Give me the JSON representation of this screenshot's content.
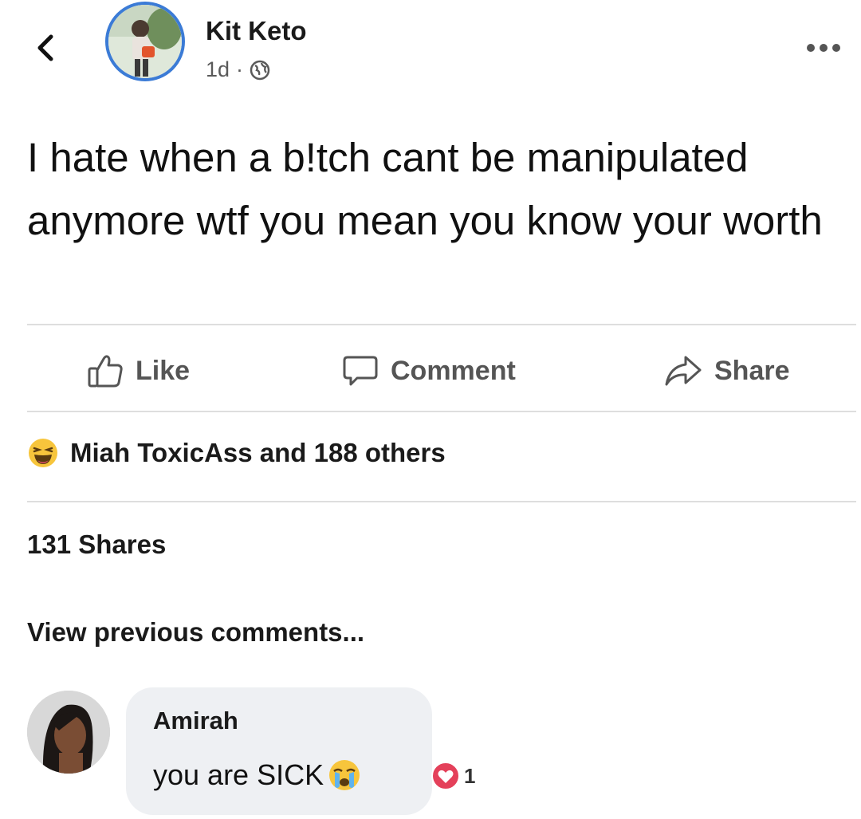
{
  "post": {
    "author": "Kit Keto",
    "time": "1d",
    "separator": "·",
    "visibility_icon": "globe-icon",
    "text": "I hate when a b!tch cant be manipulated anymore wtf you mean you know your worth"
  },
  "actions": {
    "like": "Like",
    "comment": "Comment",
    "share": "Share"
  },
  "reactions": {
    "icon": "laughing-emoji-icon",
    "summary": "Miah ToxicAss and 188 others"
  },
  "shares_count": "131 Shares",
  "view_previous": "View previous comments...",
  "comment": {
    "author": "Amirah",
    "text": "you are SICK",
    "emoji": "crying-emoji-icon",
    "reaction_icon": "heart-icon",
    "reaction_count": "1"
  },
  "colors": {
    "avatar_ring": "#3b7bd6",
    "heart_reaction": "#e4405a",
    "laugh_emoji": "#f7c53c"
  }
}
